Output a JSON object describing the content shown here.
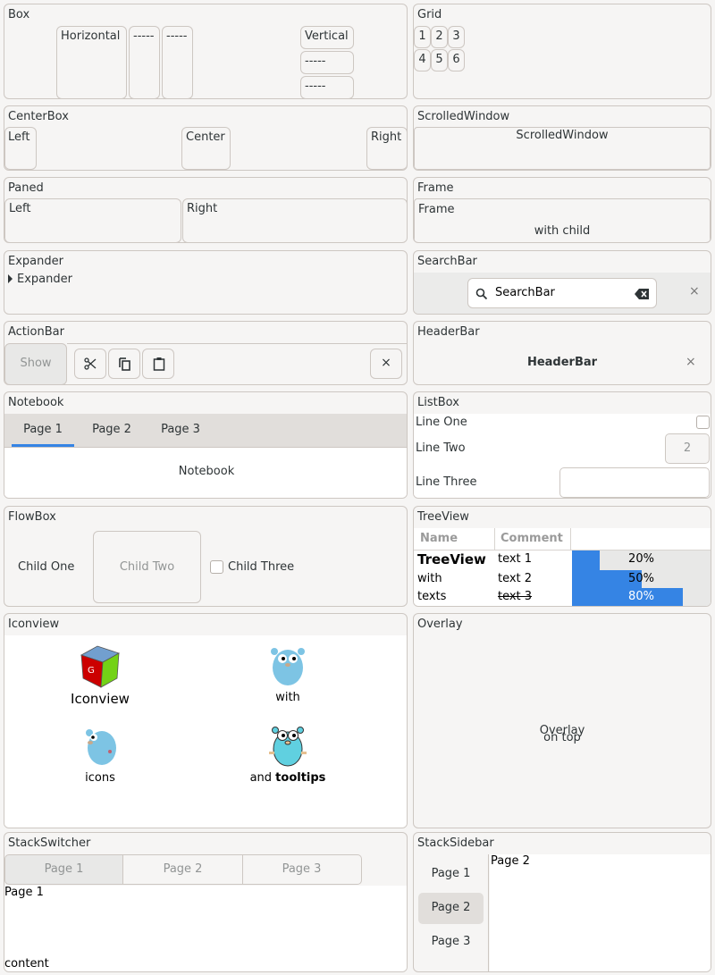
{
  "box": {
    "title": "Box",
    "horizontal": "Horizontal",
    "h2": "-----",
    "h3": "-----",
    "vertical": "Vertical",
    "v2": "-----",
    "v3": "-----"
  },
  "grid": {
    "title": "Grid",
    "cells": [
      "1",
      "2",
      "3",
      "4",
      "5",
      "6"
    ]
  },
  "centerbox": {
    "title": "CenterBox",
    "left": "Left",
    "center": "Center",
    "right": "Right"
  },
  "scrolled": {
    "title": "ScrolledWindow",
    "content": "ScrolledWindow"
  },
  "paned": {
    "title": "Paned",
    "left": "Left",
    "right": "Right"
  },
  "frame": {
    "title": "Frame",
    "label": "Frame",
    "child": "with child"
  },
  "expander": {
    "title": "Expander",
    "label": "Expander"
  },
  "searchbar": {
    "title": "SearchBar",
    "value": "SearchBar"
  },
  "actionbar": {
    "title": "ActionBar",
    "show": "Show"
  },
  "headerbar": {
    "title": "HeaderBar",
    "header": "HeaderBar"
  },
  "notebook": {
    "title": "Notebook",
    "tabs": [
      "Page 1",
      "Page 2",
      "Page 3"
    ],
    "content": "Notebook",
    "accent": "#3584e4"
  },
  "listbox": {
    "title": "ListBox",
    "rows": [
      "Line One",
      "Line Two",
      "Line Three"
    ],
    "spin_value": "2"
  },
  "flowbox": {
    "title": "FlowBox",
    "child1": "Child One",
    "child2": "Child Two",
    "child3": "Child Three"
  },
  "treeview": {
    "title": "TreeView",
    "columns": [
      "Name",
      "Comment"
    ],
    "rows": [
      {
        "name": "TreeView",
        "comment": "text 1",
        "progress": 20,
        "label": "20%"
      },
      {
        "name": "with",
        "comment": "text 2",
        "progress": 50,
        "label": "50%"
      },
      {
        "name": "texts",
        "comment": "text 3",
        "progress": 80,
        "label": "80%"
      }
    ]
  },
  "iconview": {
    "title": "Iconview",
    "items": [
      "Iconview",
      "with",
      "icons",
      "and ",
      "tooltips"
    ]
  },
  "overlay": {
    "title": "Overlay",
    "under": "Overlay",
    "over": "on top"
  },
  "stackswitcher": {
    "title": "StackSwitcher",
    "buttons": [
      "Page 1",
      "Page 2",
      "Page 3"
    ],
    "page": "Page 1",
    "content": "content"
  },
  "stacksidebar": {
    "title": "StackSidebar",
    "items": [
      "Page 1",
      "Page 2",
      "Page 3"
    ],
    "page": "Page 2"
  }
}
